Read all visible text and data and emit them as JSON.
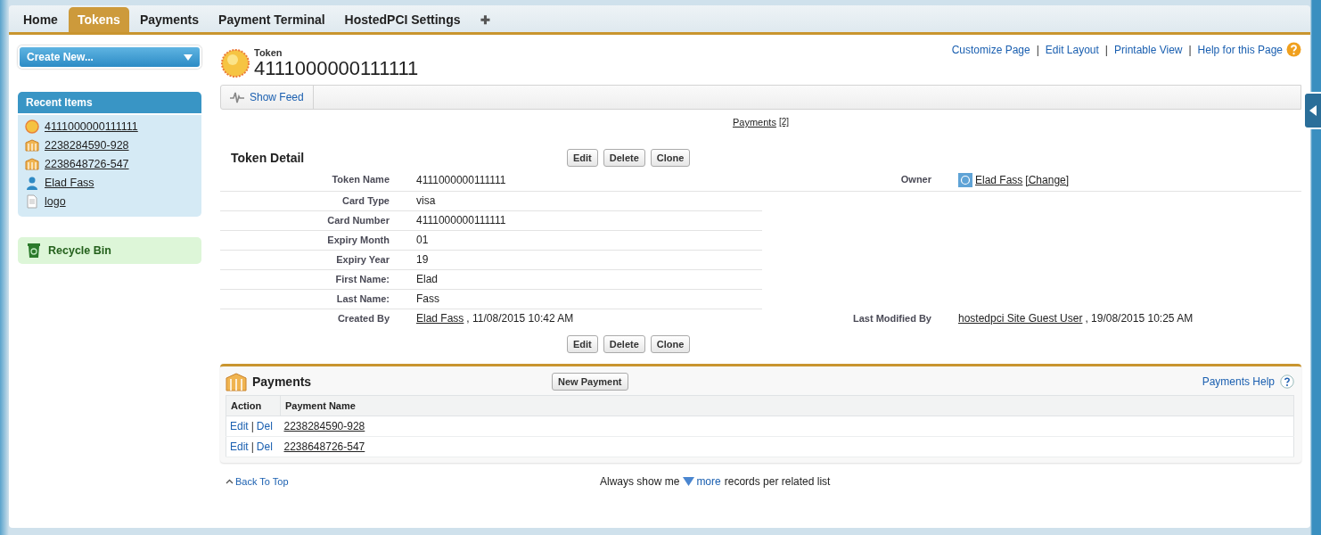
{
  "tabs": [
    {
      "label": "Home",
      "selected": false
    },
    {
      "label": "Tokens",
      "selected": true
    },
    {
      "label": "Payments",
      "selected": false
    },
    {
      "label": "Payment Terminal",
      "selected": false
    },
    {
      "label": "HostedPCI Settings",
      "selected": false
    }
  ],
  "add_tab": "✚",
  "separator": "|",
  "sidebar": {
    "create_button": "Create New...",
    "recent_title": "Recent Items",
    "recent_items": [
      {
        "label": "4111000000111111",
        "kind": "token"
      },
      {
        "label": "2238284590-928",
        "kind": "payment"
      },
      {
        "label": "2238648726-547",
        "kind": "payment"
      },
      {
        "label": "Elad Fass",
        "kind": "user"
      },
      {
        "label": "logo",
        "kind": "document"
      }
    ],
    "recycle_bin": "Recycle Bin"
  },
  "header": {
    "type_label": "Token",
    "title": "4111000000111111",
    "links": [
      "Customize Page",
      "Edit Layout",
      "Printable View",
      "Help for this Page"
    ]
  },
  "feed_button": "Show Feed",
  "related_links": [
    {
      "label": "Payments",
      "count": "[2]"
    }
  ],
  "detail": {
    "title": "Token Detail",
    "buttons": [
      "Edit",
      "Delete",
      "Clone"
    ],
    "bottom_buttons": [
      "Edit",
      "Delete",
      "Clone"
    ],
    "rows": [
      {
        "left": {
          "kind": "text",
          "label": "Token Name",
          "value": "4111000000111111"
        },
        "right": {
          "kind": "user",
          "label": "Owner",
          "link": "Elad Fass",
          "action": "[Change]"
        }
      },
      {
        "left": {
          "kind": "text",
          "label": "Card Type",
          "value": "visa"
        }
      },
      {
        "left": {
          "kind": "text",
          "label": "Card Number",
          "value": "4111000000111111"
        }
      },
      {
        "left": {
          "kind": "text",
          "label": "Expiry Month",
          "value": "01"
        }
      },
      {
        "left": {
          "kind": "text",
          "label": "Expiry Year",
          "value": "19"
        }
      },
      {
        "left": {
          "kind": "text",
          "label": "First Name:",
          "value": "Elad"
        }
      },
      {
        "left": {
          "kind": "text",
          "label": "Last Name:",
          "value": "Fass"
        }
      },
      {
        "left": {
          "kind": "link",
          "label": "Created By",
          "link": "Elad Fass",
          "suffix": ", 11/08/2015 10:42 AM"
        },
        "right": {
          "kind": "link",
          "label": "Last Modified By",
          "link": "hostedpci Site Guest User",
          "suffix": ", 19/08/2015 10:25 AM"
        }
      }
    ]
  },
  "payments": {
    "title": "Payments",
    "button": "New Payment",
    "help": "Payments Help",
    "columns": [
      "Action",
      "Payment Name"
    ],
    "rows": [
      {
        "edit": "Edit",
        "del": "Del",
        "name": "2238284590-928"
      },
      {
        "edit": "Edit",
        "del": "Del",
        "name": "2238648726-547"
      }
    ]
  },
  "footer": {
    "back_to_top": "Back To Top",
    "show_before": "Always show me",
    "show_link": "more",
    "show_after": "records per related list"
  }
}
